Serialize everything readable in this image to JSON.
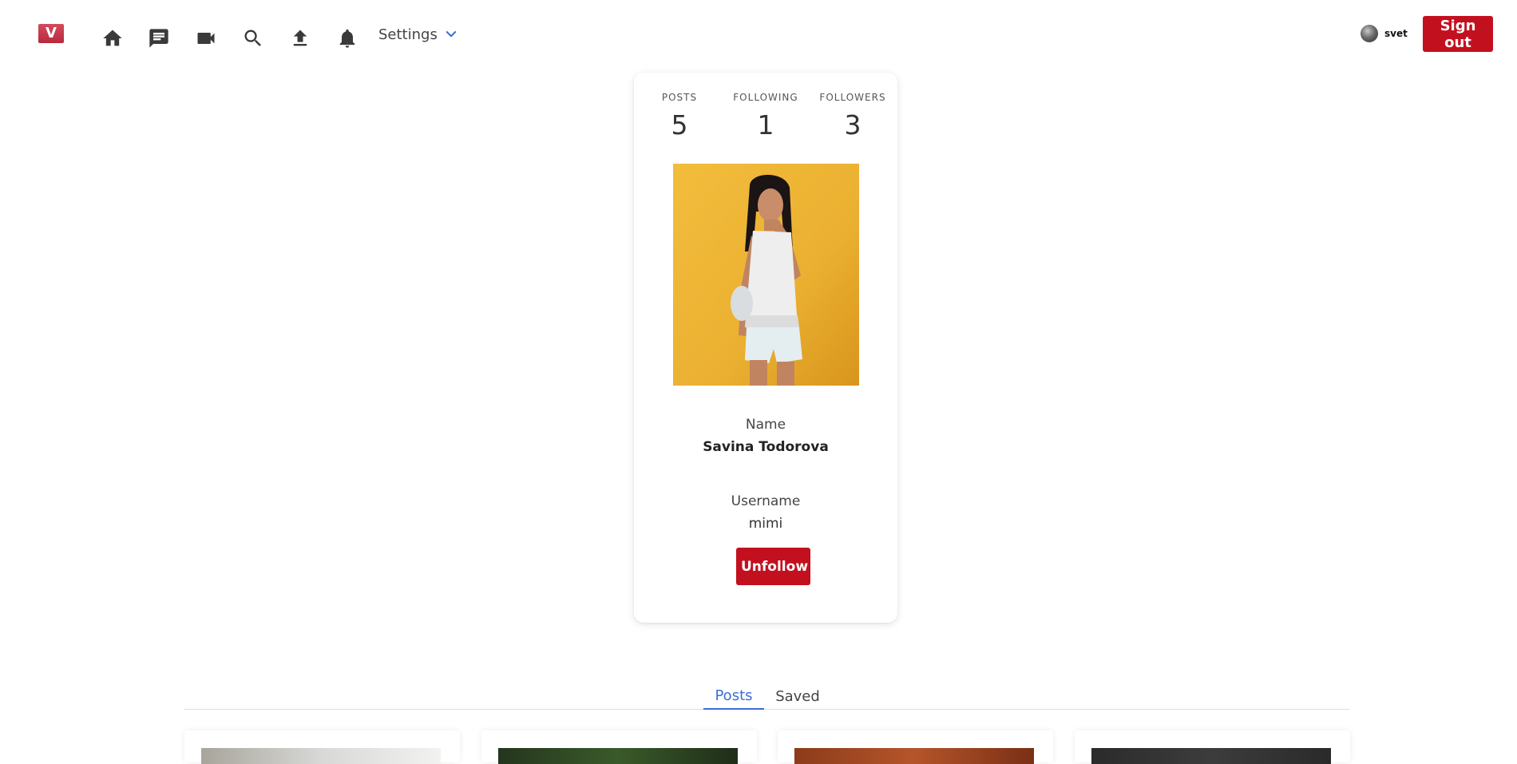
{
  "header": {
    "logo_letter": "V",
    "nav": [
      {
        "name": "home-icon",
        "label": "Home"
      },
      {
        "name": "messages-icon",
        "label": "Messages"
      },
      {
        "name": "video-icon",
        "label": "Video"
      },
      {
        "name": "search-icon",
        "label": "Search"
      },
      {
        "name": "upload-icon",
        "label": "Upload"
      },
      {
        "name": "notifications-icon",
        "label": "Notifications"
      }
    ],
    "settings_label": "Settings",
    "user_name": "svet",
    "signout_label": "Sign out"
  },
  "profile": {
    "stats": [
      {
        "label": "POSTS",
        "value": "5"
      },
      {
        "label": "FOLLOWING",
        "value": "1"
      },
      {
        "label": "FOLLOWERS",
        "value": "3"
      }
    ],
    "name_label": "Name",
    "name_value": "Savina Todorova",
    "username_label": "Username",
    "username_value": "mimi",
    "unfollow_label": "Unfollow"
  },
  "tabs": [
    {
      "label": "Posts",
      "active": true
    },
    {
      "label": "Saved",
      "active": false
    }
  ],
  "colors": {
    "brand_red": "#c3101f",
    "tab_active": "#3b6fd6",
    "photo_bg": "#f1b938"
  }
}
